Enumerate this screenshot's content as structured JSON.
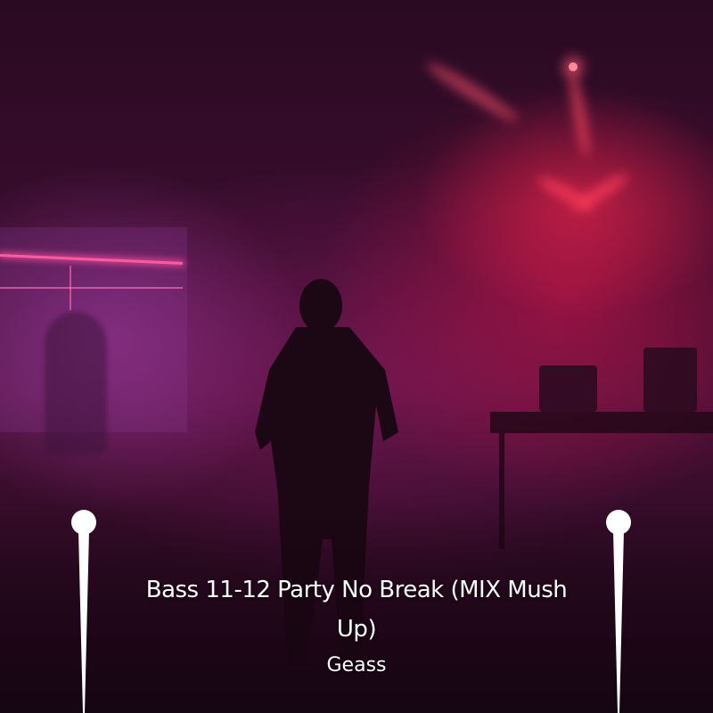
{
  "album_cover": {
    "title": "Bass 11-12 Party No Break (MIX Mush Up)",
    "artist": "Geass"
  },
  "colors": {
    "background_base": "#3a0d2e",
    "stage_light_red": "#ff2850",
    "haze_purple": "#aa3caa",
    "neon_pink": "#ff5aa0",
    "text": "#ffffff"
  },
  "decorations": {
    "left_pin_icon": "pin-icon",
    "right_pin_icon": "pin-icon"
  }
}
